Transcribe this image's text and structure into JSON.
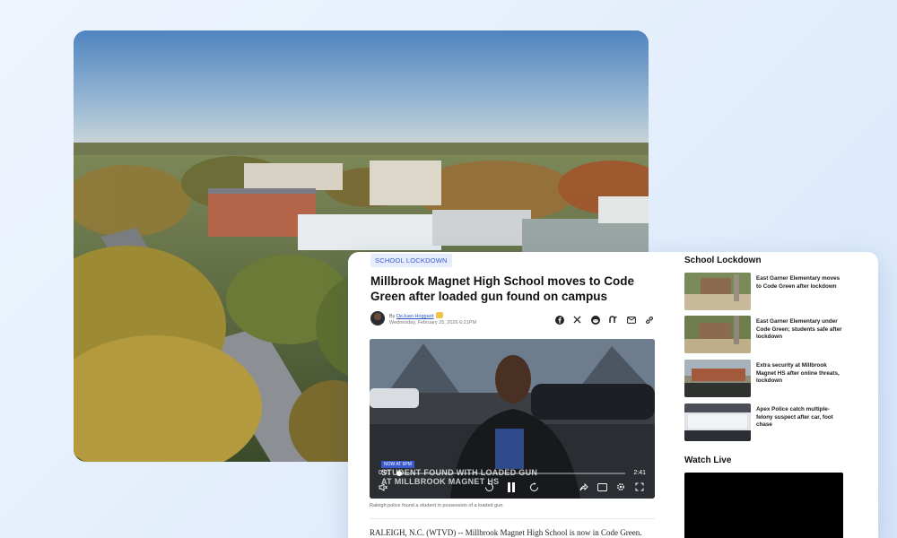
{
  "article": {
    "tag": "SCHOOL LOCKDOWN",
    "headline": "Millbrook Magnet High School moves to Code Green after loaded gun found on campus",
    "by_prefix": "By",
    "author": "DeJuan Hoggard",
    "date": "Wednesday, February 25, 2026 6:21PM",
    "share_icons": [
      "facebook-icon",
      "x-icon",
      "reddit-icon",
      "nextdoor-icon",
      "email-icon",
      "link-icon"
    ],
    "caption": "Raleigh police found a student in possession of a loaded gun.",
    "lede": "RALEIGH, N.C. (WTVD) -- Millbrook Magnet High School is now in Code Green."
  },
  "video": {
    "ticker_tag": "NOW AT 6PM",
    "ticker_line1": "STUDENT FOUND WITH LOADED GUN",
    "ticker_line2": "AT MILLBROOK MAGNET HS",
    "current_time": "0:01",
    "total_time": "2:41",
    "progress": 0.01
  },
  "sidebar": {
    "title": "School Lockdown",
    "items": [
      {
        "text": "East Garner Elementary moves to Code Green after lockdown"
      },
      {
        "text": "East Garner Elementary under Code Green; students safe after lockdown"
      },
      {
        "text": "Extra security at Millbrook Magnet HS after online threats, lockdown"
      },
      {
        "text": "Apex Police catch multiple-felony suspect after car, foot chase"
      }
    ],
    "watch_live_title": "Watch Live"
  },
  "colors": {
    "accent": "#3a5bd4",
    "tag_bg": "#e6ecfb"
  }
}
